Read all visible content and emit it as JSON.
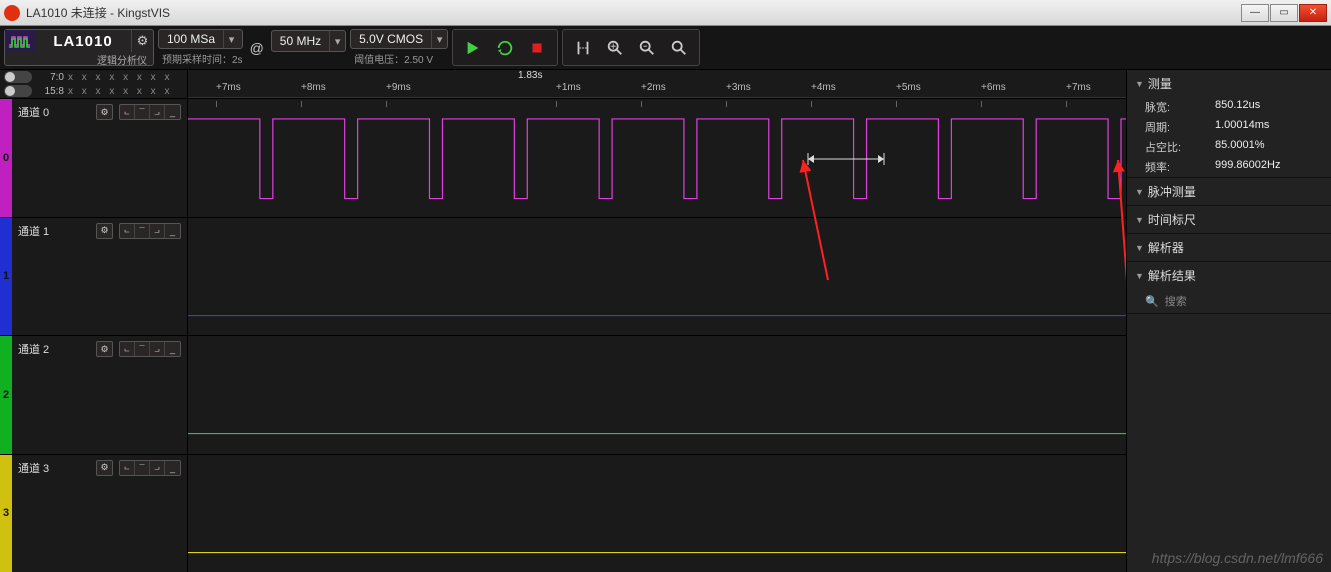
{
  "window": {
    "title": "LA1010 未连接 - KingstVIS"
  },
  "device": {
    "model": "LA1010",
    "subtitle": "逻辑分析仪"
  },
  "toolbar": {
    "sample_rate": "100 MSa",
    "sample_rate_hint": "预期采样时间：2s",
    "at": "@",
    "freq": "50 MHz",
    "logic": "5.0V CMOS",
    "threshold_hint": "阈值电压：2.50 V"
  },
  "probes": [
    {
      "label": "7:0",
      "pattern": "x x x x x x x x"
    },
    {
      "label": "15:8",
      "pattern": "x x x x x x x x"
    }
  ],
  "ruler": {
    "marker": "1.83s",
    "ticks": [
      "+7ms",
      "+8ms",
      "+9ms",
      "+1ms",
      "+2ms",
      "+3ms",
      "+4ms",
      "+5ms",
      "+6ms",
      "+7ms"
    ]
  },
  "channels": [
    {
      "name": "通道 0",
      "idx": "0",
      "color": "#c020c0"
    },
    {
      "name": "通道 1",
      "idx": "1",
      "color": "#2030d0"
    },
    {
      "name": "通道 2",
      "idx": "2",
      "color": "#10b020"
    },
    {
      "name": "通道 3",
      "idx": "3",
      "color": "#d0c010"
    }
  ],
  "measure": {
    "title": "测量",
    "rows": [
      {
        "k": "脉宽:",
        "v": "850.12us"
      },
      {
        "k": "周期:",
        "v": "1.00014ms"
      },
      {
        "k": "占空比:",
        "v": "85.0001%"
      },
      {
        "k": "频率:",
        "v": "999.86002Hz"
      }
    ]
  },
  "sections": {
    "pulse": "脉冲测量",
    "ruler": "时间标尺",
    "parser": "解析器",
    "result": "解析结果",
    "search": "搜索"
  },
  "watermark": "https://blog.csdn.net/lmf666"
}
